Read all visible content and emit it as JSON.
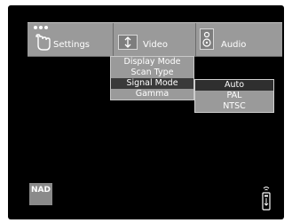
{
  "menu": {
    "tabs": [
      {
        "label": "Settings",
        "icon": "hand-pointer-icon"
      },
      {
        "label": "Video",
        "icon": "screen-arrows-icon"
      },
      {
        "label": "Audio",
        "icon": "speaker-icon"
      }
    ],
    "active_tab": "Video"
  },
  "video_menu": {
    "items": [
      "Display Mode",
      "Scan Type",
      "Signal Mode",
      "Gamma"
    ],
    "selected": "Signal Mode"
  },
  "signal_mode_submenu": {
    "items": [
      "Auto",
      "PAL",
      "NTSC"
    ],
    "selected": "Auto"
  },
  "brand": {
    "logo_text": "NAD"
  },
  "icons": {
    "remote": "remote-control-icon"
  },
  "colors": {
    "background": "#000000",
    "menu": "#9a9a9a",
    "highlight": "#333333",
    "text": "#ffffff"
  }
}
